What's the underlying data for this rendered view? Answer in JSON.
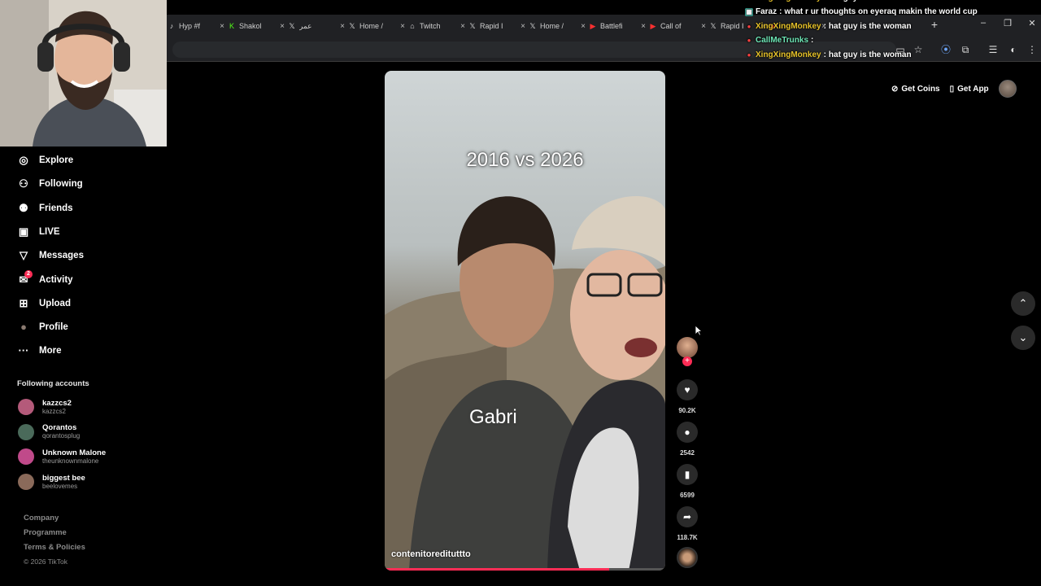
{
  "browser": {
    "tabs": [
      {
        "label": "Hyp #f",
        "icon": "tiktok-icon"
      },
      {
        "label": "Shakol",
        "icon": "kick-icon"
      },
      {
        "label": "عمر",
        "icon": "x-icon"
      },
      {
        "label": "Home /",
        "icon": "x-icon"
      },
      {
        "label": "Twitch",
        "icon": "twitch-icon"
      },
      {
        "label": "Rapid I",
        "icon": "x-icon"
      },
      {
        "label": "Home /",
        "icon": "x-icon"
      },
      {
        "label": "Battlefi",
        "icon": "youtube-icon"
      },
      {
        "label": "Call of",
        "icon": "youtube-icon"
      },
      {
        "label": "Rapid I",
        "icon": "x-icon"
      },
      {
        "label": "",
        "icon": "youtube-icon"
      }
    ],
    "new_tab": "+",
    "window_controls": {
      "minimize": "–",
      "restore": "❐",
      "close": "✕"
    }
  },
  "chat": [
    {
      "user": "XingXingMonkey",
      "message": "hat guy is the woman",
      "color": "#e6c229"
    },
    {
      "user": "Faraz",
      "message": "what r ur thoughts on eyeraq makin the world cup",
      "color": "#ffffff"
    },
    {
      "user": "XingXingMonkey",
      "message": "hat guy is the woman",
      "color": "#e6c229"
    },
    {
      "user": "CallMeTrunks",
      "message": "",
      "color": "#6ee7b7"
    },
    {
      "user": "XingXingMonkey",
      "message": "hat guy is the woman",
      "color": "#e6c229"
    }
  ],
  "sidebar": {
    "nav": [
      {
        "label": "Explore",
        "icon": "compass-icon"
      },
      {
        "label": "Following",
        "icon": "following-icon"
      },
      {
        "label": "Friends",
        "icon": "friends-icon"
      },
      {
        "label": "LIVE",
        "icon": "live-icon"
      },
      {
        "label": "Messages",
        "icon": "messages-icon"
      },
      {
        "label": "Activity",
        "icon": "activity-icon",
        "badge": "2"
      },
      {
        "label": "Upload",
        "icon": "upload-icon"
      },
      {
        "label": "Profile",
        "icon": "profile-avatar"
      },
      {
        "label": "More",
        "icon": "more-icon"
      }
    ],
    "following_title": "Following accounts",
    "accounts": [
      {
        "name": "kazzcs2",
        "handle": "kazzcs2",
        "color": "#b45a7a"
      },
      {
        "name": "Qorantos",
        "handle": "qorantosplug",
        "color": "#4a6a5a"
      },
      {
        "name": "Unknown Malone",
        "handle": "theunknownmalone",
        "color": "#c04a8a"
      },
      {
        "name": "biggest bee",
        "handle": "beelovemes",
        "color": "#8a6a5a"
      }
    ],
    "footer": [
      "Company",
      "Programme",
      "Terms & Policies"
    ],
    "copyright": "© 2026 TikTok"
  },
  "top_actions": {
    "get_coins": "Get Coins",
    "get_app": "Get App"
  },
  "video": {
    "title": "2016 vs 2026",
    "caption": "Gabri",
    "author": "contenitoredituttto",
    "progress_fraction": 0.8
  },
  "actions": {
    "likes": "90.2K",
    "comments": "2542",
    "saves": "6599",
    "shares": "118.7K"
  },
  "colors": {
    "accent": "#fe2c55",
    "background": "#000000"
  }
}
